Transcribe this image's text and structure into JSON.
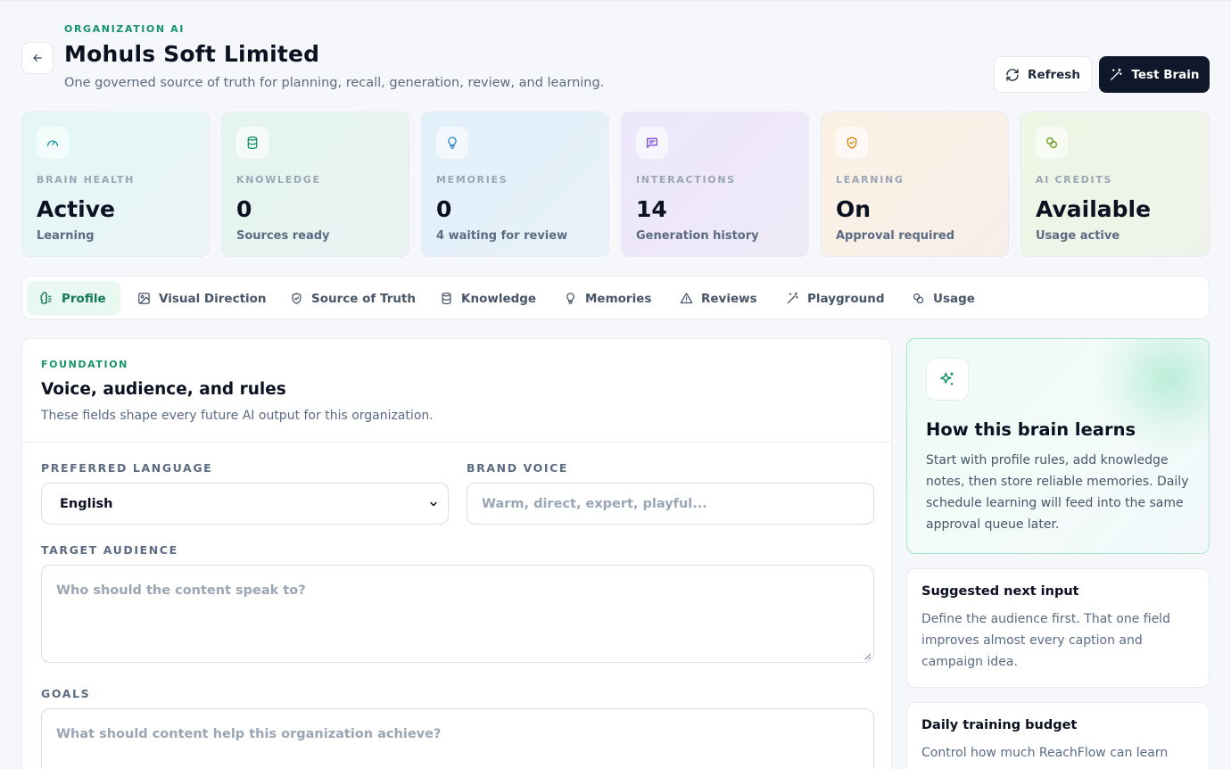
{
  "header": {
    "eyebrow": "ORGANIZATION AI",
    "title": "Mohuls Soft Limited",
    "subtitle": "One governed source of truth for planning, recall, generation, review, and learning.",
    "refresh_label": "Refresh",
    "test_label": "Test Brain"
  },
  "stats": [
    {
      "label": "BRAIN HEALTH",
      "value": "Active",
      "sub": "Learning",
      "icon": "gauge-icon"
    },
    {
      "label": "KNOWLEDGE",
      "value": "0",
      "sub": "Sources ready",
      "icon": "database-icon"
    },
    {
      "label": "MEMORIES",
      "value": "0",
      "sub": "4 waiting for review",
      "icon": "lightbulb-icon"
    },
    {
      "label": "INTERACTIONS",
      "value": "14",
      "sub": "Generation history",
      "icon": "message-icon"
    },
    {
      "label": "LEARNING",
      "value": "On",
      "sub": "Approval required",
      "icon": "shield-check-icon"
    },
    {
      "label": "AI CREDITS",
      "value": "Available",
      "sub": "Usage active",
      "icon": "coins-icon"
    }
  ],
  "tabs": [
    {
      "label": "Profile",
      "icon": "brain-icon",
      "active": true
    },
    {
      "label": "Visual Direction",
      "icon": "image-icon"
    },
    {
      "label": "Source of Truth",
      "icon": "shield-check-icon"
    },
    {
      "label": "Knowledge",
      "icon": "database-icon"
    },
    {
      "label": "Memories",
      "icon": "lightbulb-icon"
    },
    {
      "label": "Reviews",
      "icon": "warning-icon"
    },
    {
      "label": "Playground",
      "icon": "wand-icon"
    },
    {
      "label": "Usage",
      "icon": "coins-icon"
    }
  ],
  "foundation": {
    "eyebrow": "FOUNDATION",
    "title": "Voice, audience, and rules",
    "desc": "These fields shape every future AI output for this organization.",
    "language_label": "PREFERRED LANGUAGE",
    "language_value": "English",
    "voice_label": "BRAND VOICE",
    "voice_placeholder": "Warm, direct, expert, playful...",
    "audience_label": "TARGET AUDIENCE",
    "audience_placeholder": "Who should the content speak to?",
    "goals_label": "GOALS",
    "goals_placeholder": "What should content help this organization achieve?"
  },
  "learn": {
    "title": "How this brain learns",
    "body": "Start with profile rules, add knowledge notes, then store reliable memories. Daily schedule learning will feed into the same approval queue later."
  },
  "suggested": {
    "title": "Suggested next input",
    "body": "Define the audience first. That one field improves almost every caption and campaign idea."
  },
  "budget": {
    "title": "Daily training budget",
    "body": "Control how much ReachFlow can learn"
  },
  "colors": {
    "accent": "#15936a",
    "dark_button": "#0f172a"
  }
}
